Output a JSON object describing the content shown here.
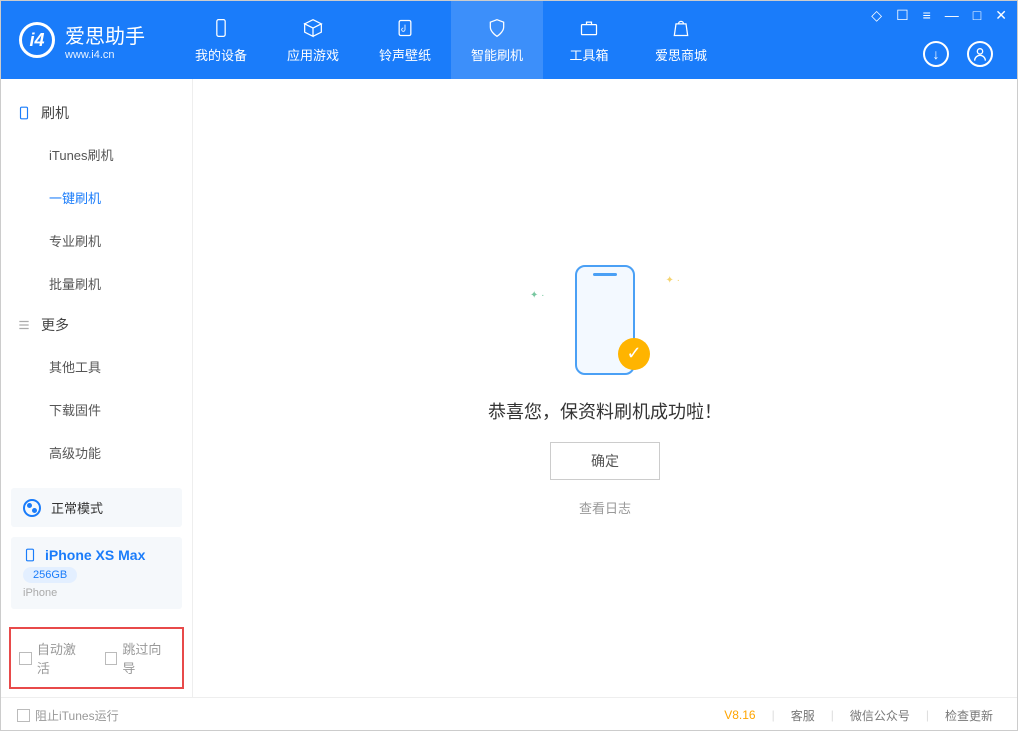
{
  "logo": {
    "main": "爱思助手",
    "sub": "www.i4.cn"
  },
  "topnav": {
    "device": "我的设备",
    "apps": "应用游戏",
    "ringtone": "铃声壁纸",
    "flash": "智能刷机",
    "toolbox": "工具箱",
    "store": "爱思商城"
  },
  "sidebar": {
    "group1": "刷机",
    "itunes": "iTunes刷机",
    "oneclick": "一键刷机",
    "pro": "专业刷机",
    "batch": "批量刷机",
    "group2": "更多",
    "other": "其他工具",
    "firmware": "下载固件",
    "advanced": "高级功能"
  },
  "mode": "正常模式",
  "device": {
    "name": "iPhone XS Max",
    "storage": "256GB",
    "type": "iPhone"
  },
  "options": {
    "auto_activate": "自动激活",
    "skip_guide": "跳过向导"
  },
  "main": {
    "success": "恭喜您，保资料刷机成功啦！",
    "ok": "确定",
    "log": "查看日志"
  },
  "status": {
    "block_itunes": "阻止iTunes运行",
    "version": "V8.16",
    "cs": "客服",
    "wechat": "微信公众号",
    "update": "检查更新"
  }
}
